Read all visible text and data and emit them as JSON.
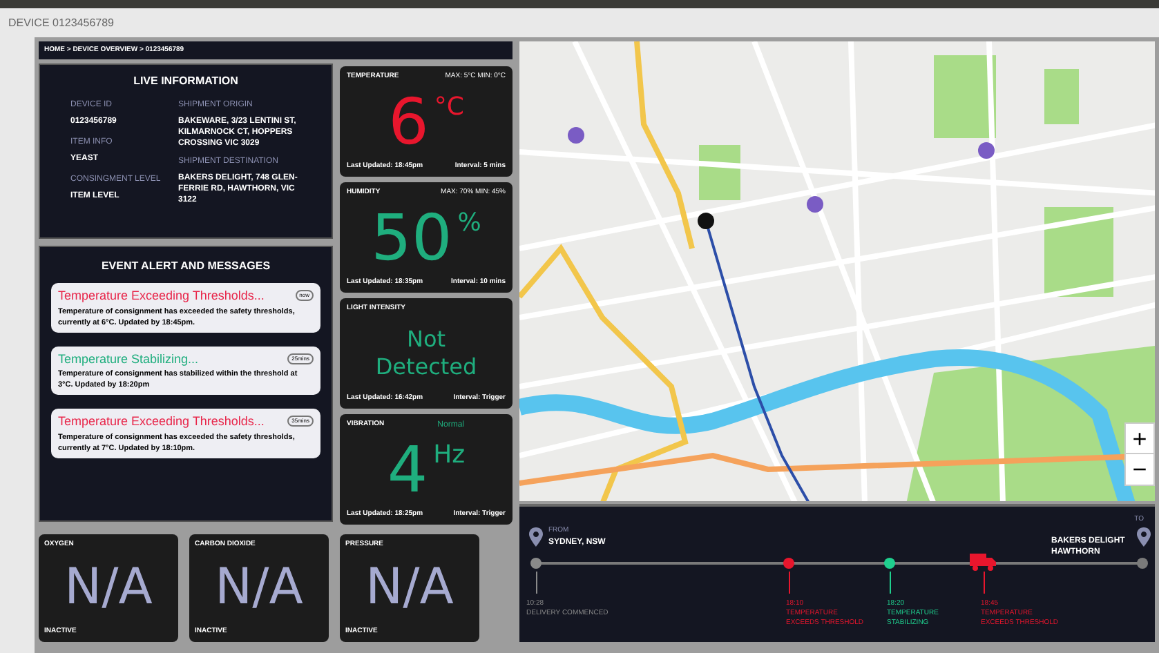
{
  "header": {
    "title": "DEVICE 0123456789"
  },
  "breadcrumb": "HOME > DEVICE OVERVIEW > 0123456789",
  "live_information": {
    "title": "LIVE INFORMATION",
    "left_fields": [
      {
        "label": "DEVICE ID",
        "value": "0123456789"
      },
      {
        "label": "ITEM INFO",
        "value": "YEAST"
      },
      {
        "label": "CONSINGMENT LEVEL",
        "value": "ITEM LEVEL"
      }
    ],
    "right_fields": [
      {
        "label": "SHIPMENT ORIGIN",
        "value": "BAKEWARE, 3/23 LENTINI ST, KILMARNOCK CT, HOPPERS CROSSING VIC 3029"
      },
      {
        "label": "SHIPMENT DESTINATION",
        "value": "BAKERS DELIGHT, 748 GLEN-FERRIE RD, HAWTHORN, VIC 3122"
      }
    ]
  },
  "events": {
    "title": "EVENT ALERT AND MESSAGES",
    "alerts": [
      {
        "title": "Temperature Exceeding Thresholds...",
        "color": "#e8264a",
        "badge": "now",
        "message": "Temperature of consignment has exceeded the safety thresholds, currently at 6°C. Updated by 18:45pm."
      },
      {
        "title": "Temperature Stabilizing...",
        "color": "#1fae7e",
        "badge": "25mins",
        "message": "Temperature of consignment has stabilized within the threshold at 3°C. Updated by 18:20pm"
      },
      {
        "title": "Temperature Exceeding Thresholds...",
        "color": "#e8264a",
        "badge": "35mins",
        "message": "Temperature of consignment has exceeded the safety thresholds, currently at 7°C. Updated by 18:10pm."
      }
    ]
  },
  "sensors": [
    {
      "kind": "reading",
      "label": "TEMPERATURE",
      "range": "MAX: 5°C  MIN: 0°C",
      "value": "6",
      "unit": "°C",
      "color": "#e8162d",
      "last_updated": "Last Updated: 18:45pm",
      "interval": "Interval: 5 mins"
    },
    {
      "kind": "reading",
      "label": "HUMIDITY",
      "range": "MAX: 70%  MIN: 45%",
      "value": "50",
      "unit": "%",
      "color": "#1fae7e",
      "last_updated": "Last Updated: 18:35pm",
      "interval": "Interval: 10 mins"
    },
    {
      "kind": "text",
      "label": "LIGHT INTENSITY",
      "value": "Not Detected",
      "color": "#1fae7e",
      "last_updated": "Last Updated: 16:42pm",
      "interval": "Interval: Trigger"
    },
    {
      "kind": "reading",
      "label": "VIBRATION",
      "status": "Normal",
      "value": "4",
      "unit": "Hz",
      "color": "#1fae7e",
      "last_updated": "Last Updated: 18:25pm",
      "interval": "Interval: Trigger"
    }
  ],
  "inactive_sensors": [
    {
      "label": "OXYGEN",
      "value": "N/A",
      "state": "INACTIVE"
    },
    {
      "label": "CARBON DIOXIDE",
      "value": "N/A",
      "state": "INACTIVE"
    },
    {
      "label": "PRESSURE",
      "value": "N/A",
      "state": "INACTIVE"
    }
  ],
  "map": {
    "zoom_in": "+",
    "zoom_out": "−"
  },
  "timeline": {
    "from_label": "FROM",
    "from": "SYDNEY, NSW",
    "to_label": "TO",
    "to": "BAKERS DELIGHT HAWTHORN",
    "events": [
      {
        "kind": "start",
        "time": "10:28",
        "text": "DELIVERY COMMENCED",
        "color": "#8a8a8a"
      },
      {
        "kind": "dot",
        "time": "18:10",
        "text": "TEMPERATURE EXCEEDS THRESHOLD",
        "color": "#e8162d"
      },
      {
        "kind": "dot",
        "time": "18:20",
        "text": "TEMPERATURE STABILIZING",
        "color": "#1fcf8e"
      },
      {
        "kind": "truck",
        "time": "18:45",
        "text": "TEMPERATURE EXCEEDS THRESHOLD",
        "color": "#e8162d"
      }
    ]
  }
}
